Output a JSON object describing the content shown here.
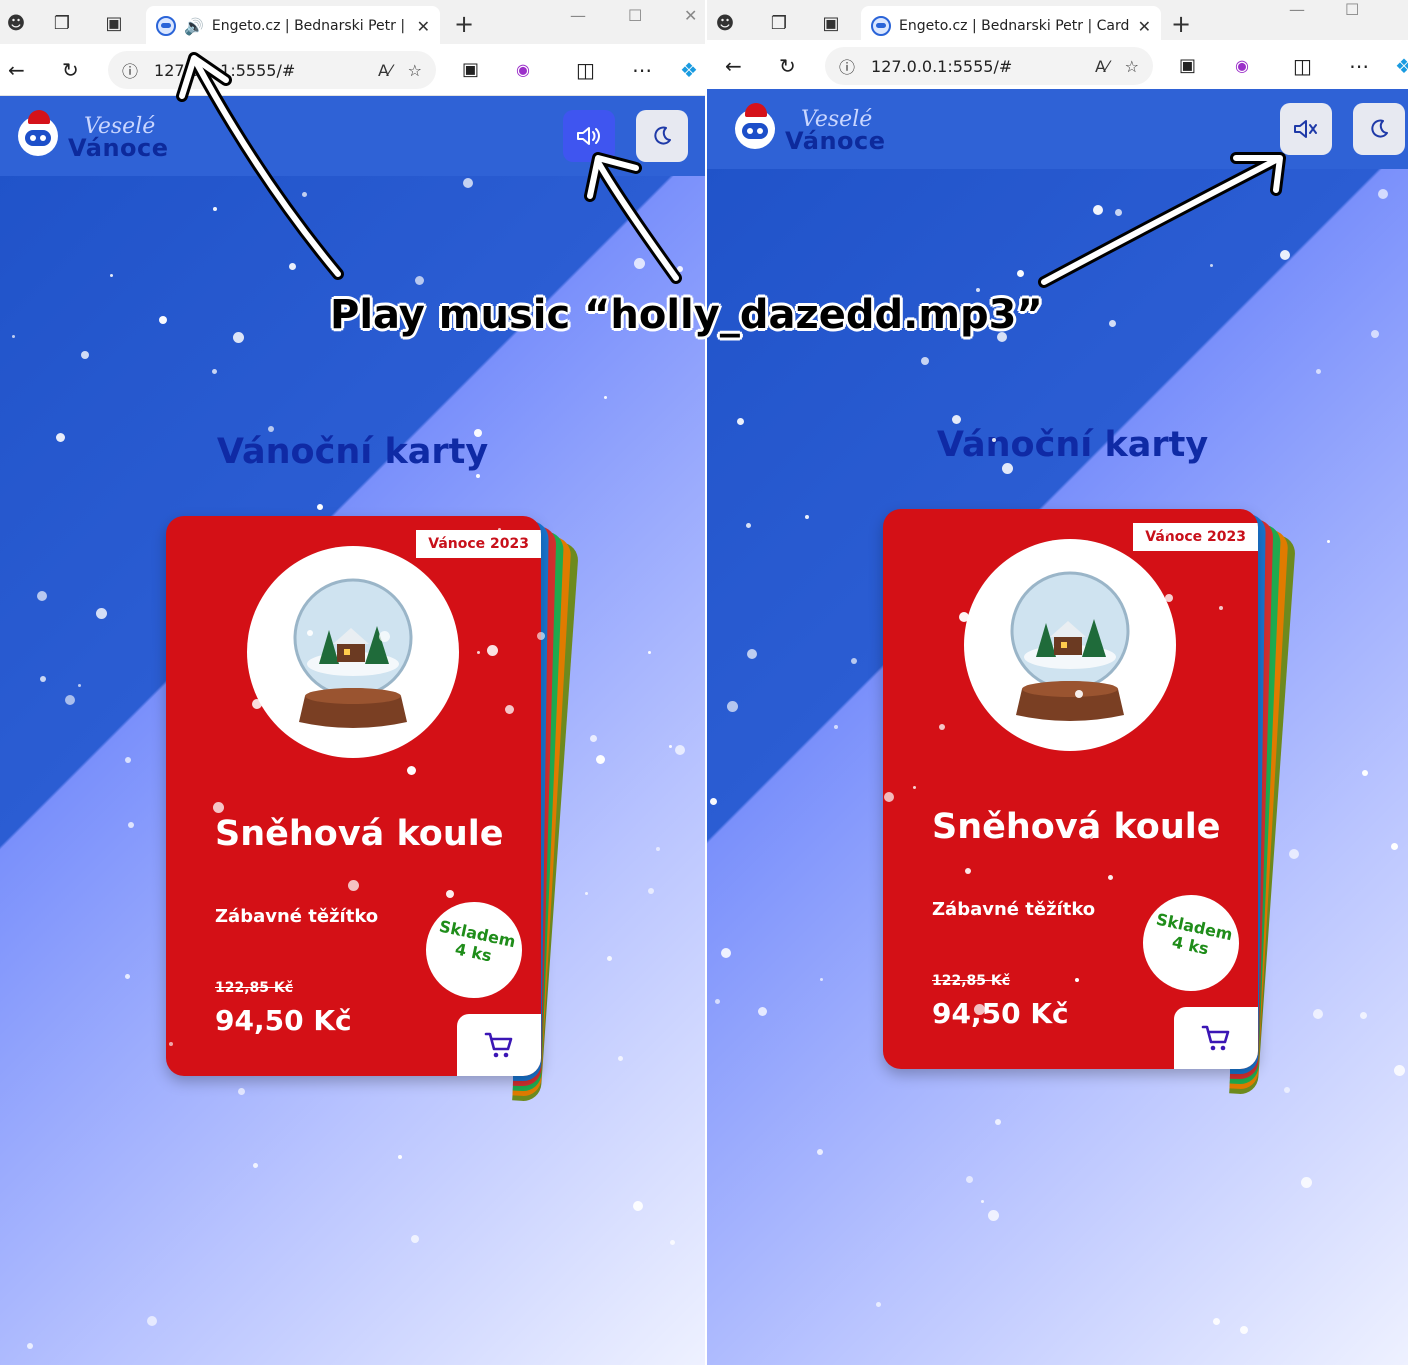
{
  "annotation": {
    "text": "Play music “holly_dazedd.mp3”"
  },
  "panes": [
    {
      "id": "left",
      "tab_title": "Engeto.cz | Bednarski Petr | C",
      "tab_sound_icon": "speaker-icon",
      "url": "127.0.0.1:5555/#",
      "logo_top": "Veselé",
      "logo_bottom": "Vánoce",
      "sound_button_state": "on",
      "section_title": "Vánoční karty",
      "card": {
        "badge": "Vánoce 2023",
        "name": "Sněhová koule",
        "subtitle": "Zábavné těžítko",
        "stock": "Skladem",
        "stock_count": "4 ks",
        "old_price": "122,85 Kč",
        "price": "94,50 Kč",
        "image": "snow-globe-image"
      }
    },
    {
      "id": "right",
      "tab_title": "Engeto.cz | Bednarski Petr | Cards",
      "url": "127.0.0.1:5555/#",
      "logo_top": "Veselé",
      "logo_bottom": "Vánoce",
      "sound_button_state": "muted",
      "section_title": "Vánoční karty",
      "card": {
        "badge": "Vánoce 2023",
        "name": "Sněhová koule",
        "subtitle": "Zábavné těžítko",
        "stock": "Skladem",
        "stock_count": "4 ks",
        "old_price": "122,85 Kč",
        "price": "94,50 Kč",
        "image": "snow-globe-image"
      }
    }
  ],
  "back_card_colors": [
    "#1976d2",
    "#d32f2f",
    "#1faa4f",
    "#e07b00",
    "#6d8a1e"
  ],
  "colors": {
    "header": "#2f62d6",
    "card_red": "#d41016",
    "title_blue": "#0f2aa5",
    "sound_active": "#3f55f0"
  }
}
